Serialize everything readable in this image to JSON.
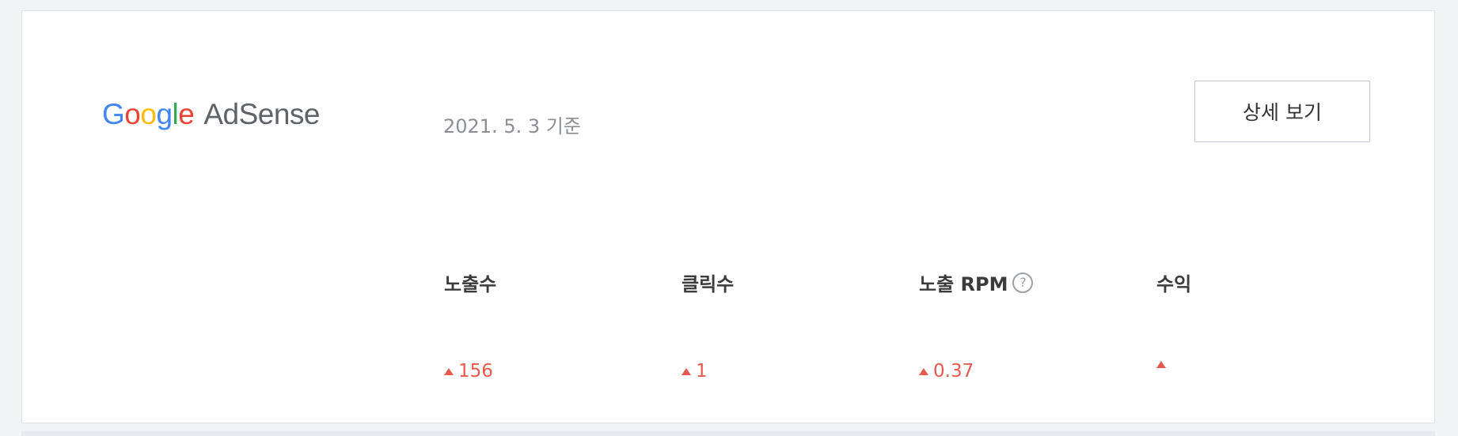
{
  "logo": {
    "google_letters": [
      {
        "char": "G",
        "color": "#4285f4"
      },
      {
        "char": "o",
        "color": "#ea4335"
      },
      {
        "char": "o",
        "color": "#fbbc05"
      },
      {
        "char": "g",
        "color": "#4285f4"
      },
      {
        "char": "l",
        "color": "#34a853"
      },
      {
        "char": "e",
        "color": "#ea4335"
      }
    ],
    "product": "AdSense"
  },
  "date_label": "2021. 5. 3 기준",
  "detail_button": "상세 보기",
  "metrics": [
    {
      "label": "노출수",
      "value": "156",
      "trend": "up"
    },
    {
      "label": "클릭수",
      "value": "1",
      "trend": "up"
    },
    {
      "label": "노출 RPM",
      "value": "0.37",
      "trend": "up",
      "help_icon": "question-circle-icon",
      "help_glyph": "?"
    },
    {
      "label": "수익",
      "value": "",
      "trend": "up"
    }
  ],
  "colors": {
    "trend_up": "#e55a4e",
    "label_text": "#3b3b3b",
    "date_text": "#8a8e94"
  }
}
